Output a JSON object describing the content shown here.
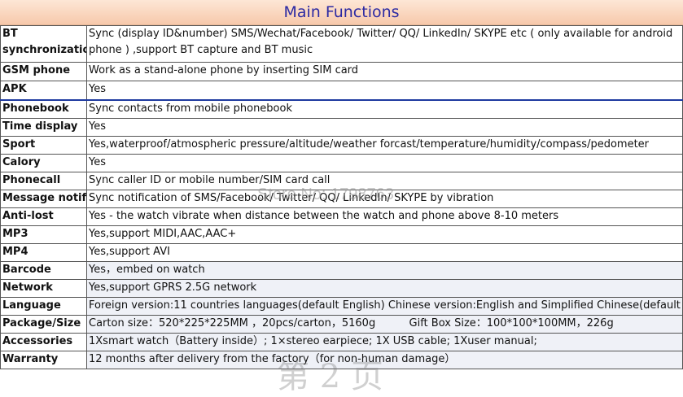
{
  "header": {
    "title": "Main Functions"
  },
  "rows": [
    {
      "label": "BT synchronizatio",
      "value": "Sync (display ID&number) SMS/Wechat/Facebook/ Twitter/ QQ/ LinkedIn/ SKYPE etc ( only available for android phone ) ,support BT capture and BT music"
    },
    {
      "label": "GSM phone",
      "value": "Work as a stand-alone phone by inserting SIM card"
    },
    {
      "label": "APK",
      "value": "Yes"
    },
    {
      "label": "Phonebook",
      "value": "Sync contacts from mobile phonebook"
    },
    {
      "label": "Time display",
      "value": "Yes"
    },
    {
      "label": "Sport",
      "value": "Yes,waterproof/atmospheric pressure/altitude/weather forcast/temperature/humidity/compass/pedometer"
    },
    {
      "label": "Calory",
      "value": "Yes"
    },
    {
      "label": "Phonecall",
      "value": "Sync caller ID or mobile number/SIM card call"
    },
    {
      "label": "Message notify",
      "value": "Sync notification of SMS/Facebook/ Twitter/ QQ/ LinkedIn/ SKYPE by vibration"
    },
    {
      "label": "Anti-lost",
      "value": "Yes - the watch vibrate when distance between the watch and phone above 8-10 meters"
    },
    {
      "label": "MP3",
      "value": "Yes,support MIDI,AAC,AAC+"
    },
    {
      "label": "MP4",
      "value": "Yes,support AVI"
    },
    {
      "label": "Barcode",
      "value": "Yes，embed on watch"
    },
    {
      "label": "Network",
      "value": "Yes,support GPRS 2.5G network"
    },
    {
      "label": "Language",
      "value": "Foreign version:11 countries languages(default English)  Chinese version:English and Simplified Chinese(default"
    },
    {
      "label": "Package/Size",
      "value": "Carton size：520*225*225MM ，20pcs/carton，5160g          Gift Box Size：100*100*100MM，226g"
    },
    {
      "label": "Accessories",
      "value": "1Xsmart watch（Battery inside）; 1×stereo earpiece; 1X USB cable; 1Xuser manual;"
    },
    {
      "label": "Warranty",
      "value": "12 months after delivery from the factory（for non-human damage）"
    }
  ],
  "watermark": {
    "store": "Store No: 1798763",
    "page": "第 2 页"
  }
}
